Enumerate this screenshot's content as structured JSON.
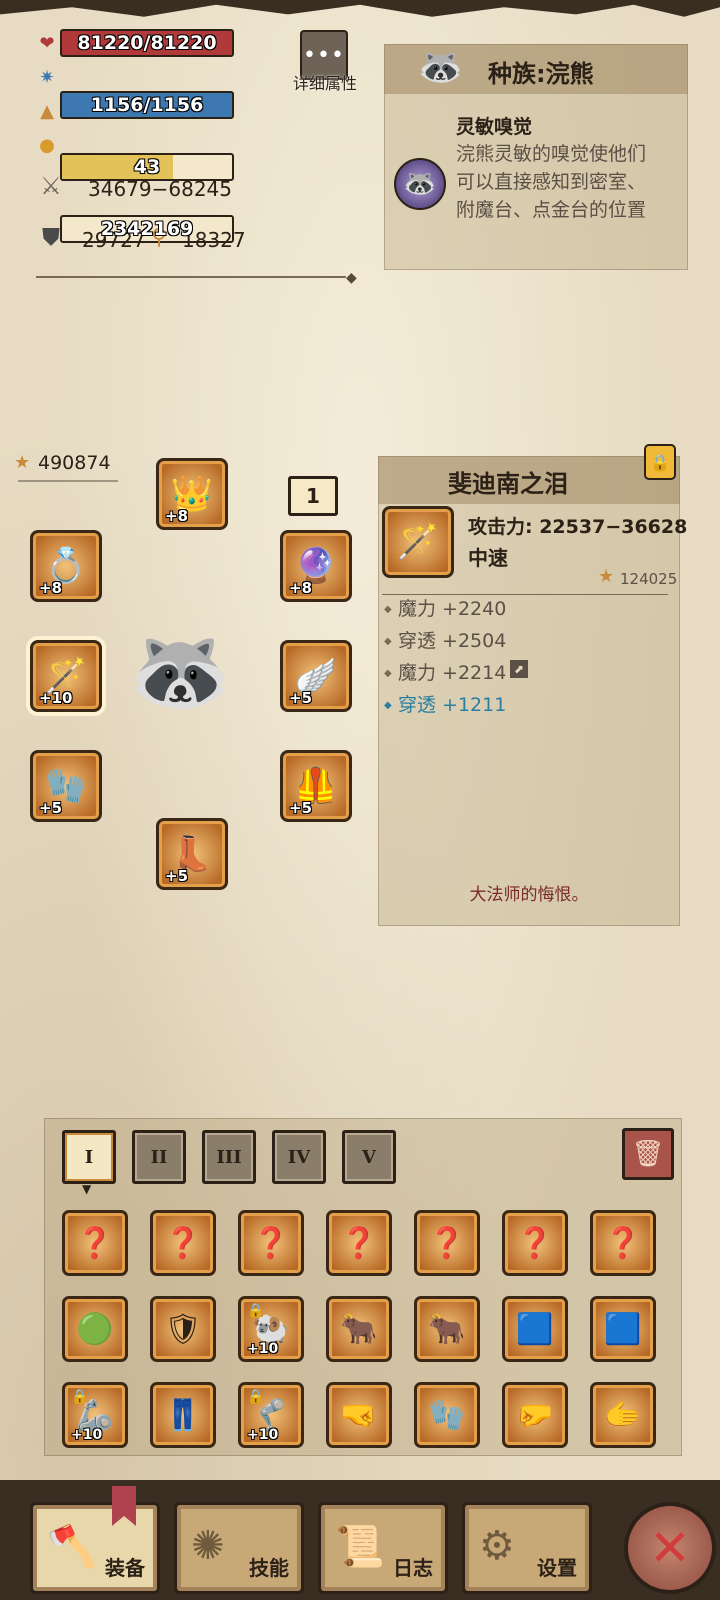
{
  "stats": {
    "hp": "81220/81220",
    "mp": "1156/1156",
    "level": "43",
    "gold": "2342169",
    "attack": "34679−68245",
    "defense": "29727",
    "magic": "18327",
    "hp_color": "#b03a3a",
    "mp_color": "#3d79b0",
    "level_color": "#e3c25a"
  },
  "detail_button": {
    "icon": "ellipsis-icon",
    "label": "详细属性",
    "dots": "•••"
  },
  "race": {
    "title": "种族:浣熊",
    "ability_name": "灵敏嗅觉",
    "description": "浣熊灵敏的嗅觉使他们可以直接感知到密室、附魔台、点金台的位置"
  },
  "equipment": {
    "score": "490874",
    "page_indicator": "1",
    "slots": [
      {
        "name": "crown",
        "plus": "+8",
        "icon": "👑"
      },
      {
        "name": "ring",
        "plus": "+8",
        "icon": "💍"
      },
      {
        "name": "amulet",
        "plus": "+8",
        "icon": "🔮"
      },
      {
        "name": "staff",
        "plus": "+10",
        "icon": "🪄"
      },
      {
        "name": "wings",
        "plus": "+5",
        "icon": "🪽"
      },
      {
        "name": "gauntlet",
        "plus": "+5",
        "icon": "🧤"
      },
      {
        "name": "armor",
        "plus": "+5",
        "icon": "🦺"
      },
      {
        "name": "boots",
        "plus": "+5",
        "icon": "👢"
      }
    ]
  },
  "item": {
    "name": "斐迪南之泪",
    "attack": "攻击力: 22537−36628",
    "speed": "中速",
    "score": "124025",
    "stats": [
      {
        "text": "魔力 +2240"
      },
      {
        "text": "穿透 +2504"
      },
      {
        "text": "魔力 +2214"
      },
      {
        "text": "穿透 +1211"
      }
    ],
    "flavor": "大法师的悔恨。"
  },
  "inventory": {
    "tabs": [
      "I",
      "II",
      "III",
      "IV",
      "V"
    ],
    "active_tab": "I",
    "row1": [
      {
        "icon": "❓"
      },
      {
        "icon": "❓"
      },
      {
        "icon": "❓"
      },
      {
        "icon": "❓"
      },
      {
        "icon": "❓"
      },
      {
        "icon": "❓"
      },
      {
        "icon": "❓"
      }
    ],
    "row2": [
      {
        "icon": "🟢",
        "plus": ""
      },
      {
        "icon": "🛡",
        "plus": ""
      },
      {
        "icon": "🐏",
        "plus": "+10",
        "locked": true
      },
      {
        "icon": "🐂",
        "plus": ""
      },
      {
        "icon": "🐂",
        "plus": ""
      },
      {
        "icon": "🟦",
        "plus": ""
      },
      {
        "icon": "🟦",
        "plus": ""
      }
    ],
    "row3": [
      {
        "icon": "🦾",
        "plus": "+10",
        "locked": true
      },
      {
        "icon": "👖",
        "plus": ""
      },
      {
        "icon": "🦿",
        "plus": "+10",
        "locked": true
      },
      {
        "icon": "🤜",
        "plus": ""
      },
      {
        "icon": "🧤",
        "plus": ""
      },
      {
        "icon": "🤛",
        "plus": ""
      },
      {
        "icon": "🫱",
        "plus": ""
      }
    ]
  },
  "nav": {
    "equip": "装备",
    "skills": "技能",
    "log": "日志",
    "settings": "设置",
    "close": "✕"
  }
}
